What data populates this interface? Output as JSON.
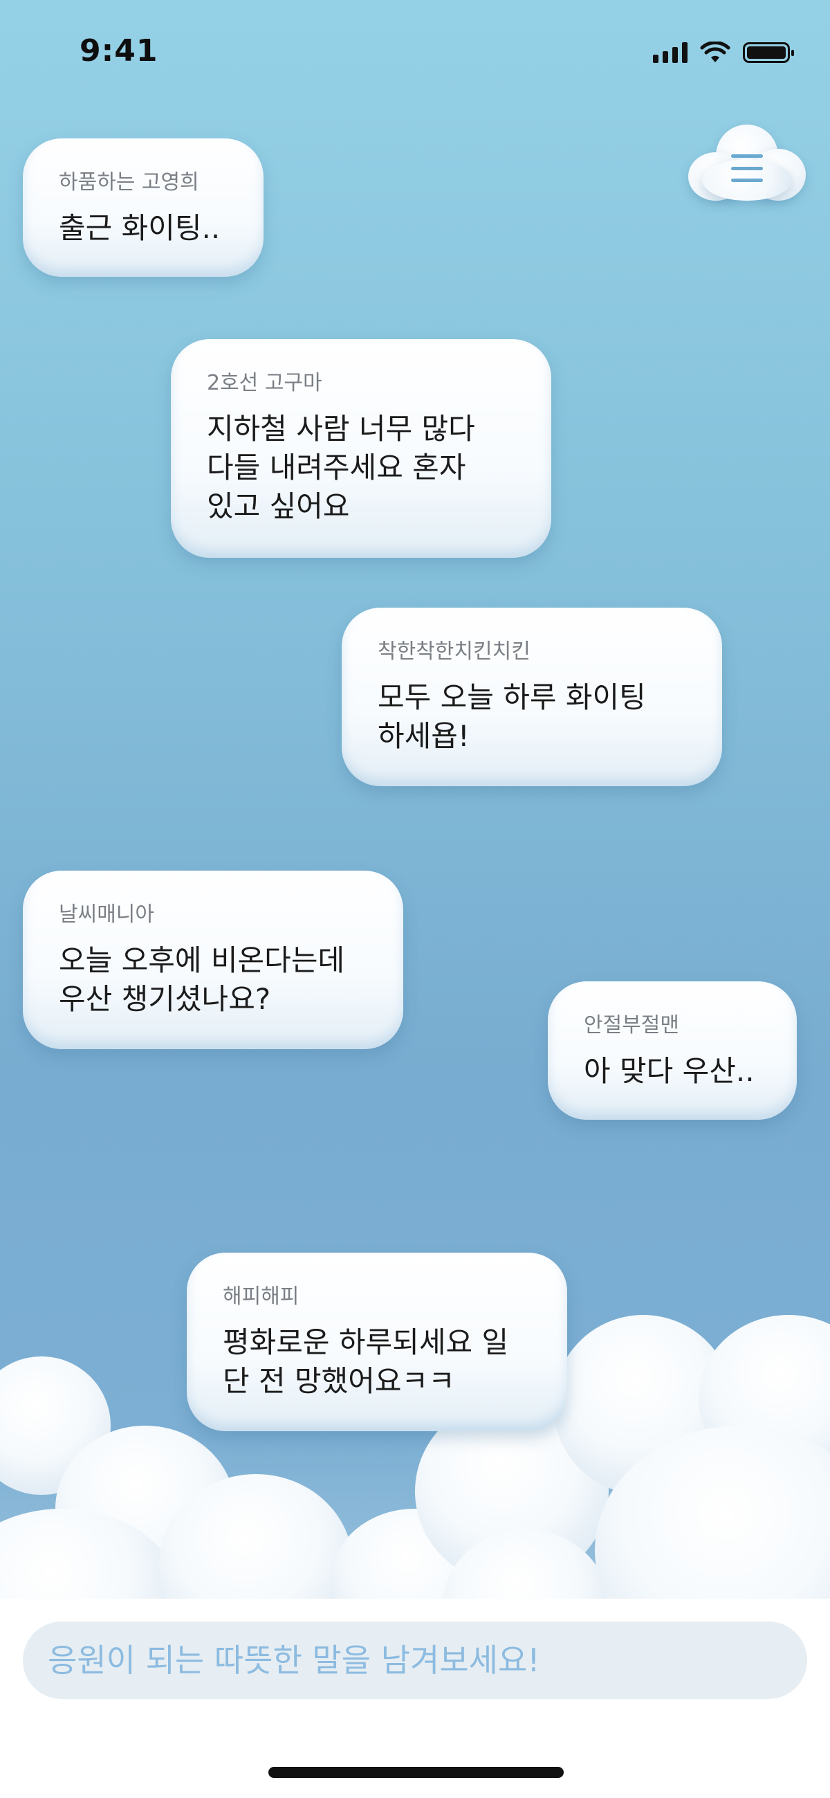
{
  "status_bar": {
    "time": "9:41"
  },
  "posts": [
    {
      "nickname": "하품하는 고영희",
      "message": "출근 화이팅.."
    },
    {
      "nickname": "2호선 고구마",
      "message": "지하철 사람 너무 많다\n다들 내려주세요 혼자\n있고 싶어요"
    },
    {
      "nickname": "착한착한치킨치킨",
      "message": "모두 오늘 하루 화이팅\n하세욥!"
    },
    {
      "nickname": "날씨매니아",
      "message": "오늘 오후에 비온다는데\n우산 챙기셨나요?"
    },
    {
      "nickname": "안절부절맨",
      "message": "아 맞다 우산.."
    },
    {
      "nickname": "해피해피",
      "message": "평화로운 하루되세요 일\n단 전 망했어요ㅋㅋ"
    }
  ],
  "composer": {
    "placeholder": "응원이 되는 따뜻한 말을 남겨보세요!"
  },
  "icons": {
    "menu": "hamburger-menu-icon",
    "signal": "cellular-signal-icon",
    "wifi": "wifi-icon",
    "battery": "battery-icon"
  },
  "colors": {
    "sky_top": "#95d1e6",
    "sky_bottom": "#7cafd3",
    "accent": "#6aa8cf",
    "placeholder": "#8dbbe0"
  }
}
